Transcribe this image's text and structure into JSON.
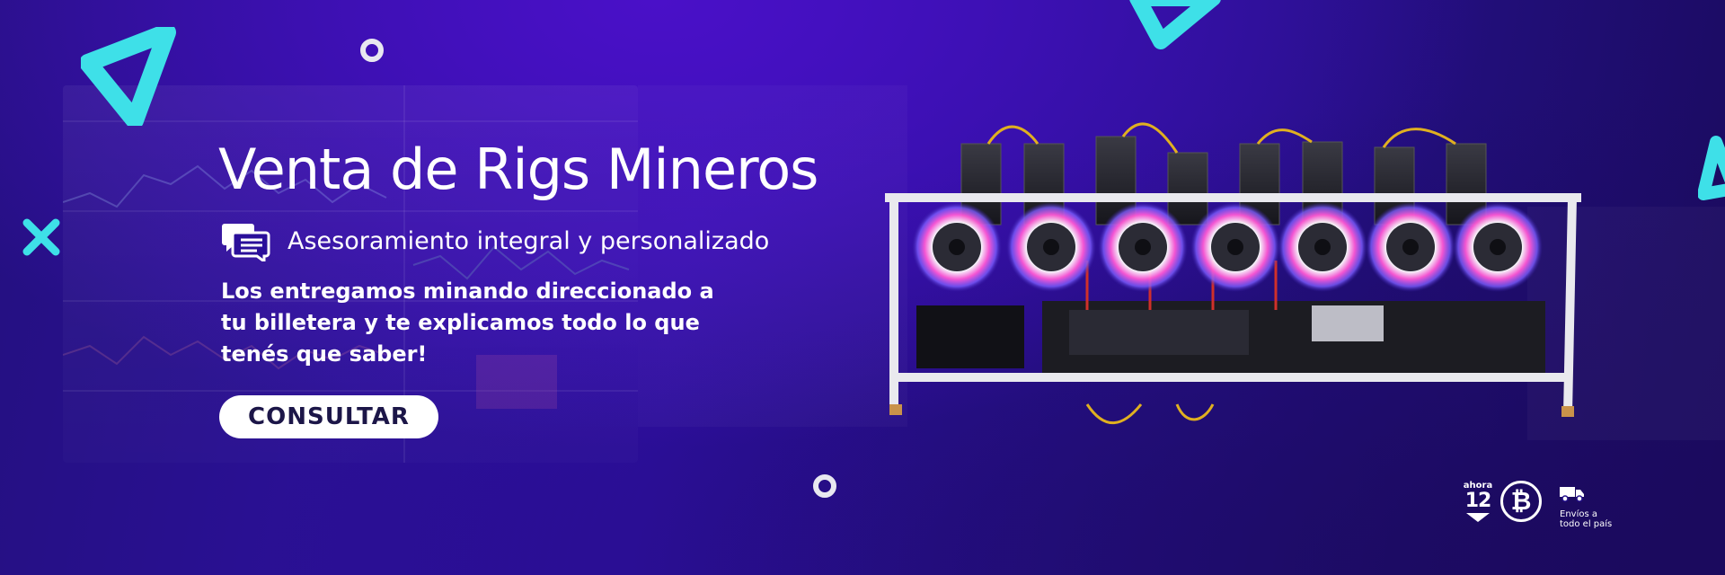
{
  "banner": {
    "headline": "Venta de Rigs Mineros",
    "feature": {
      "icon": "chat-bubbles-icon",
      "text": "Asesoramiento integral y personalizado"
    },
    "description": "Los entregamos minando direccionado a tu billetera y te explicamos todo lo que tenés que saber!",
    "cta_label": "CONSULTAR",
    "product_image": "gpu-mining-rig-image",
    "badges": {
      "installments": {
        "label": "ahora",
        "number": "12",
        "icon": "arrow-down-icon"
      },
      "bitcoin": {
        "icon": "bitcoin-icon",
        "symbol": "₿"
      },
      "shipping": {
        "icon": "truck-icon",
        "text": "Envíos a\ntodo el país"
      }
    }
  },
  "colors": {
    "background": "#2a0f9a",
    "accent_cyan": "#3ee0e8",
    "text": "#ffffff",
    "button_bg": "#ffffff",
    "button_text": "#1c1648",
    "fan_ring": "#ff4fd8"
  }
}
